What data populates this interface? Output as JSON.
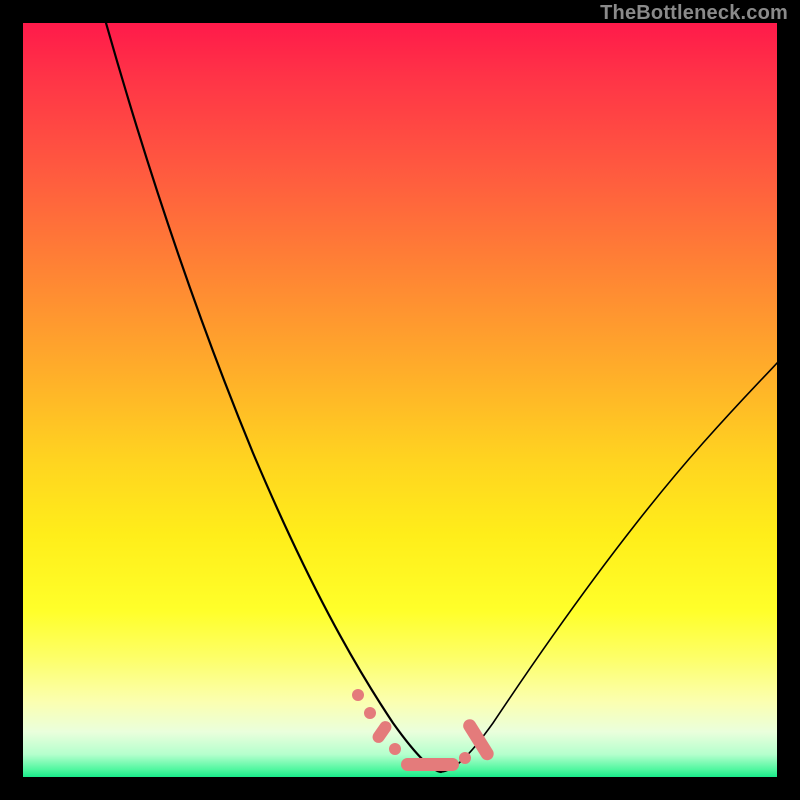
{
  "watermark": {
    "text": "TheBottleneck.com"
  },
  "colors": {
    "curve": "#000000",
    "marker_fill": "#e47b7b",
    "marker_stroke": "#c95f5f",
    "gradient_top": "#ff1a4a",
    "gradient_bottom": "#19e98a"
  },
  "chart_data": {
    "type": "line",
    "title": "",
    "xlabel": "",
    "ylabel": "",
    "xlim": [
      0,
      100
    ],
    "ylim": [
      0,
      100
    ],
    "grid": false,
    "legend": false,
    "axes_visible": false,
    "note": "Values are approximate, read from pixel positions. y=0 is bottom (green), y=100 is top (red).",
    "series": [
      {
        "name": "left-curve",
        "x": [
          11,
          14,
          18,
          22,
          26,
          30,
          34,
          38,
          42,
          44,
          46,
          48,
          50,
          52,
          54,
          55
        ],
        "y": [
          100,
          90,
          79,
          68,
          57,
          46,
          36,
          26,
          17,
          13,
          10,
          7,
          5,
          3,
          2,
          1.5
        ]
      },
      {
        "name": "right-curve",
        "x": [
          55,
          57,
          60,
          63,
          66,
          70,
          74,
          78,
          83,
          88,
          93,
          98,
          100
        ],
        "y": [
          1.5,
          2,
          4,
          7,
          11,
          16,
          22,
          28,
          35,
          42,
          48,
          54,
          56
        ]
      }
    ],
    "markers": {
      "name": "highlight-band-pink",
      "note": "Pink rounded segments near the minimum",
      "points": [
        {
          "x": 44.5,
          "y": 10.5
        },
        {
          "x": 46.0,
          "y": 8.0
        },
        {
          "x": 47.5,
          "y": 6.0
        },
        {
          "x": 49.0,
          "y": 4.0
        },
        {
          "x": 51.0,
          "y": 2.2
        },
        {
          "x": 53.0,
          "y": 1.5
        },
        {
          "x": 55.0,
          "y": 1.5
        },
        {
          "x": 57.0,
          "y": 2.0
        },
        {
          "x": 58.5,
          "y": 3.0
        },
        {
          "x": 60.0,
          "y": 5.5
        },
        {
          "x": 61.0,
          "y": 8.0
        },
        {
          "x": 61.8,
          "y": 10.5
        }
      ]
    }
  }
}
